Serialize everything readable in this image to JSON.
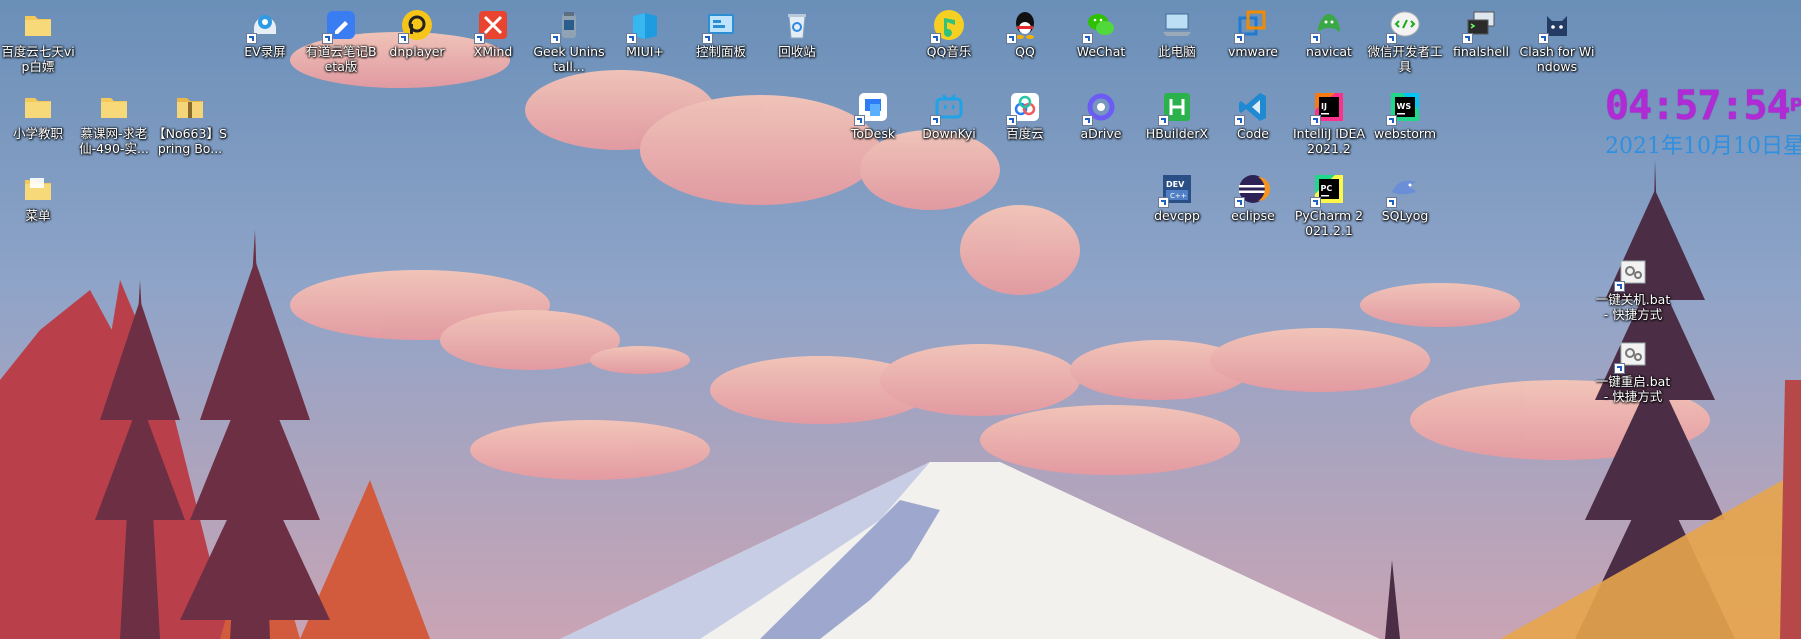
{
  "desktop": {
    "icons": [
      {
        "label": "百度云七天vip白嫖",
        "icon": "folder-icon"
      },
      {
        "label": "小学教职",
        "icon": "folder-icon"
      },
      {
        "label": "菜单",
        "icon": "folder-icon"
      },
      {
        "label": "慕课网-求老仙-490-实...",
        "icon": "folder-icon"
      },
      {
        "label": "【No663】Spring Bo...",
        "icon": "zip-folder-icon"
      },
      {
        "label": "EV录屏",
        "icon": "ev-recorder-icon"
      },
      {
        "label": "有道云笔记Beta版",
        "icon": "youdao-note-icon"
      },
      {
        "label": "dnplayer",
        "icon": "dnplayer-icon"
      },
      {
        "label": "XMind",
        "icon": "xmind-icon"
      },
      {
        "label": "Geek Uninstall...",
        "icon": "geek-uninstaller-icon"
      },
      {
        "label": "MIUI+",
        "icon": "miui-plus-icon"
      },
      {
        "label": "控制面板",
        "icon": "control-panel-icon"
      },
      {
        "label": "回收站",
        "icon": "recycle-bin-icon"
      },
      {
        "label": "QQ音乐",
        "icon": "qq-music-icon"
      },
      {
        "label": "QQ",
        "icon": "qq-icon"
      },
      {
        "label": "WeChat",
        "icon": "wechat-icon"
      },
      {
        "label": "此电脑",
        "icon": "this-pc-icon"
      },
      {
        "label": "vmware",
        "icon": "vmware-icon"
      },
      {
        "label": "navicat",
        "icon": "navicat-icon"
      },
      {
        "label": "微信开发者工具",
        "icon": "wechat-devtools-icon"
      },
      {
        "label": "finalshell",
        "icon": "finalshell-icon"
      },
      {
        "label": "Clash for Windows",
        "icon": "clash-icon"
      },
      {
        "label": "ToDesk",
        "icon": "todesk-icon"
      },
      {
        "label": "DownKyi",
        "icon": "downkyi-icon"
      },
      {
        "label": "百度云",
        "icon": "baidu-cloud-icon"
      },
      {
        "label": "aDrive",
        "icon": "adrive-icon"
      },
      {
        "label": "HBuilderX",
        "icon": "hbuilderx-icon"
      },
      {
        "label": "Code",
        "icon": "vscode-icon"
      },
      {
        "label": "IntelliJ IDEA 2021.2",
        "icon": "intellij-idea-icon"
      },
      {
        "label": "webstorm",
        "icon": "webstorm-icon"
      },
      {
        "label": "devcpp",
        "icon": "devcpp-icon"
      },
      {
        "label": "eclipse",
        "icon": "eclipse-icon"
      },
      {
        "label": "PyCharm 2021.2.1",
        "icon": "pycharm-icon"
      },
      {
        "label": "SQLyog",
        "icon": "sqlyog-icon"
      },
      {
        "label": "一键关机.bat - 快捷方式",
        "icon": "batch-file-icon"
      },
      {
        "label": "一键重启.bat - 快捷方式",
        "icon": "batch-file-icon"
      }
    ]
  },
  "clock": {
    "time": "04:57:54",
    "ampm": "PM",
    "date": "2021年10月10日星",
    "time_color": "#b02bd6",
    "date_color": "#2f8fe0"
  }
}
